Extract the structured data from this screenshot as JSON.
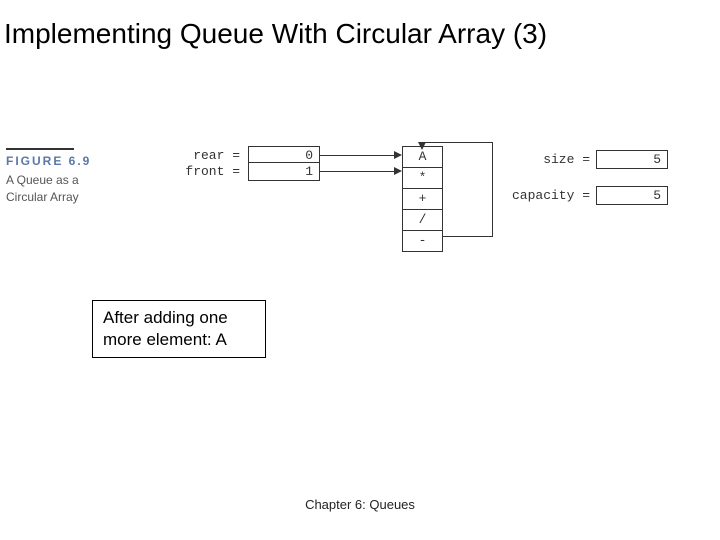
{
  "title": "Implementing Queue With Circular Array (3)",
  "figure": {
    "number": "FIGURE 6.9",
    "text1": "A Queue as a",
    "text2": "Circular Array"
  },
  "vars": {
    "rear_label": "rear =",
    "rear_value": "0",
    "front_label": "front =",
    "front_value": "1",
    "size_label": "size =",
    "size_value": "5",
    "capacity_label": "capacity =",
    "capacity_value": "5"
  },
  "array": {
    "cell0": "A",
    "cell1": "*",
    "cell2": "+",
    "cell3": "/",
    "cell4": "-"
  },
  "note": {
    "line1": "After adding one",
    "line2": "more element: A"
  },
  "footer": "Chapter 6: Queues"
}
